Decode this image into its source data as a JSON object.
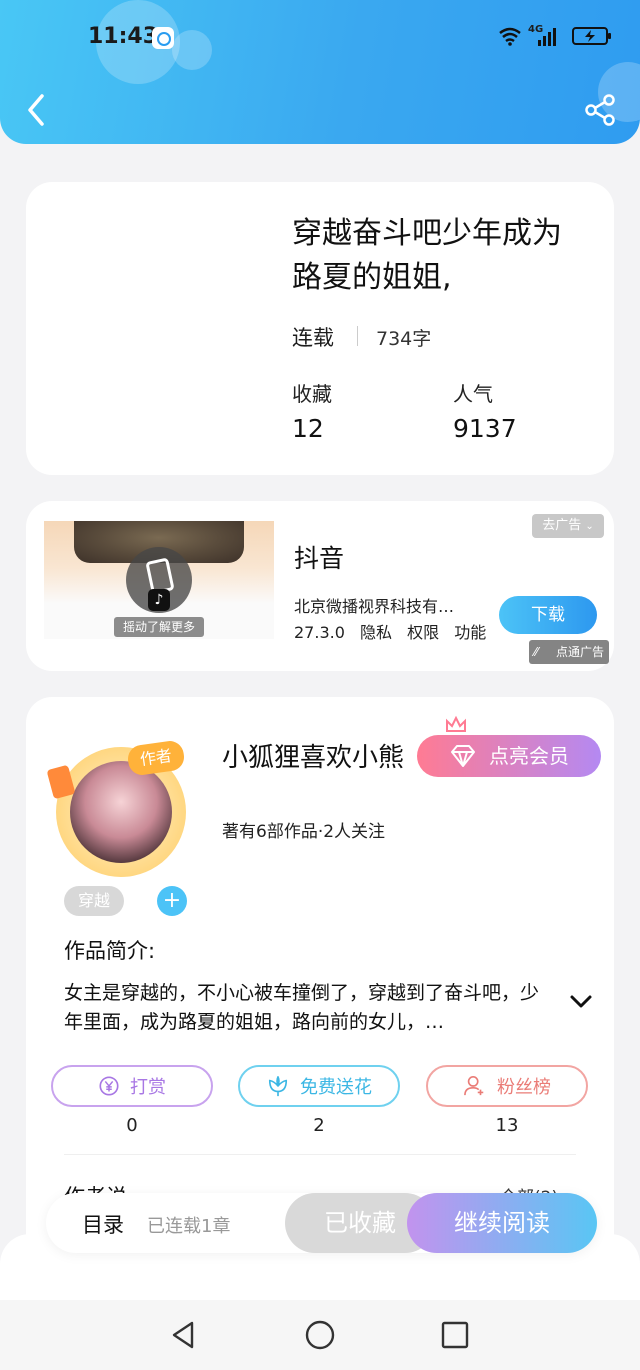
{
  "status_bar": {
    "time": "11:43",
    "network": "4G"
  },
  "book": {
    "title": "穿越奋斗吧少年成为路夏的姐姐,",
    "status": "连载",
    "word_count": "734字",
    "favorites_label": "收藏",
    "favorites_value": "12",
    "popularity_label": "人气",
    "popularity_value": "9137"
  },
  "ad": {
    "title": "抖音",
    "company": "北京微播视界科技有…",
    "version": "27.3.0",
    "privacy": "隐私",
    "permissions": "权限",
    "features": "功能",
    "remove_label": "去广告",
    "download_label": "下载",
    "shake_text": "摇动了解更多",
    "source_label": "点通广告"
  },
  "author": {
    "badge": "作者",
    "name": "小狐狸喜欢小熊",
    "vip_label": "点亮会员",
    "works": "著有6部作品·2人关注",
    "tag": "穿越",
    "intro_label": "作品简介:",
    "intro_text": "女主是穿越的，不小心被车撞倒了，穿越到了奋斗吧，少年里面，成为路夏的姐姐，路向前的女儿，…",
    "actions": [
      {
        "label": "打赏",
        "count": "0",
        "icon": "yen-icon"
      },
      {
        "label": "免费送花",
        "count": "2",
        "icon": "flower-icon"
      },
      {
        "label": "粉丝榜",
        "count": "13",
        "icon": "fans-icon"
      }
    ],
    "says_label": "作者说",
    "all_link": "全部(2)"
  },
  "action_bar": {
    "toc": "目录",
    "serial_info": "已连载1章",
    "collected": "已收藏",
    "continue": "继续阅读"
  },
  "colors": {
    "header": "#3aa8f0",
    "accent": "#4cc3f7",
    "vip_gradient_start": "#ff7b93",
    "vip_gradient_end": "#b489f2"
  }
}
